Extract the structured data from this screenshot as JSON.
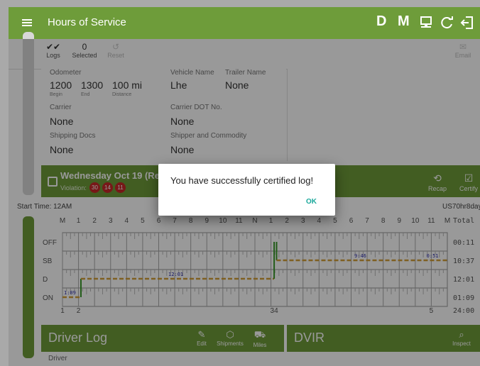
{
  "appbar": {
    "title": "Hours of Service",
    "icons": [
      "D",
      "M"
    ]
  },
  "toolbar": {
    "logs_label": "Logs",
    "selected_count": "0",
    "selected_label": "Selected",
    "reset_label": "Reset",
    "email_label": "Email"
  },
  "info": {
    "odometer_label": "Odometer",
    "odo_begin": "1200",
    "odo_begin_sub": "Begin",
    "odo_end": "1300",
    "odo_end_sub": "End",
    "distance": "100 mi",
    "distance_sub": "Distance",
    "vehicle_label": "Vehicle Name",
    "vehicle_value": "Lhe",
    "trailer_label": "Trailer Name",
    "trailer_value": "None",
    "carrier_label": "Carrier",
    "carrier_value": "None",
    "dot_label": "Carrier DOT No.",
    "dot_value": "None",
    "shipping_label": "Shipping Docs",
    "shipping_value": "None",
    "shipper_label": "Shipper and Commodity",
    "shipper_value": "None"
  },
  "logheader": {
    "date": "Wednesday Oct 19 (Recen",
    "violation_label": "Violation:",
    "violations": [
      "30",
      "14",
      "11"
    ],
    "recap_label": "Recap",
    "certify_label": "Certify"
  },
  "graph": {
    "start_time": "Start Time: 12AM",
    "cycle": "US70hr8days",
    "hours": [
      "M",
      "1",
      "2",
      "3",
      "4",
      "5",
      "6",
      "7",
      "8",
      "9",
      "10",
      "11",
      "N",
      "1",
      "2",
      "3",
      "4",
      "5",
      "6",
      "7",
      "8",
      "9",
      "10",
      "11",
      "M"
    ],
    "total_label": "Total",
    "rows": [
      "OFF",
      "SB",
      "D",
      "ON"
    ],
    "totals": [
      "00:11",
      "10:37",
      "12:01",
      "01:09"
    ],
    "grand_total": "24:00",
    "markers": [
      "1",
      "2",
      "34",
      "5"
    ],
    "seg_labels": [
      "1:09",
      "12:01",
      "9:46",
      "0:51"
    ]
  },
  "driverlog": {
    "title": "Driver Log",
    "edit": "Edit",
    "shipments": "Shipments",
    "miles": "Miles",
    "driver_label": "Driver"
  },
  "dvir": {
    "title": "DVIR",
    "inspect": "Inspect"
  },
  "dialog": {
    "message": "You have successfully certified log!",
    "ok": "OK"
  },
  "colors": {
    "accent": "#6e9c3a",
    "violation": "#c62828",
    "ok": "#1aa89b",
    "driving": "#3a9a2a",
    "sleeper": "#d4a03a"
  }
}
